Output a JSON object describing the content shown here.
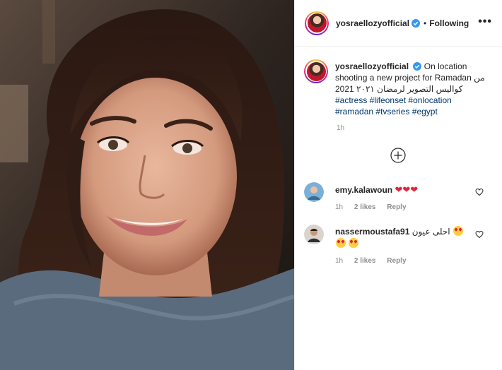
{
  "post": {
    "username": "yosraellozyofficial",
    "follow_label": "Following",
    "separator": "•",
    "more_label": "•••",
    "caption_text": "On location shooting a new project for Ramadan من كواليس التصوير لرمضان ٢٠٢١ 2021",
    "hashtags": [
      "#actress",
      "#lifeonset",
      "#onlocation",
      "#ramadan",
      "#tvseries",
      "#egypt"
    ],
    "time": "1h"
  },
  "comments": [
    {
      "username": "emy.kalawoun",
      "text": "❤❤❤",
      "time": "1h",
      "likes": "2 likes",
      "reply": "Reply"
    },
    {
      "username": "nassermoustafa91",
      "text": "احلى عيون",
      "time": "1h",
      "likes": "2 likes",
      "reply": "Reply"
    }
  ],
  "colors": {
    "hashtag": "#00376b",
    "verified": "#3897f0",
    "muted": "#8e8e8e"
  }
}
